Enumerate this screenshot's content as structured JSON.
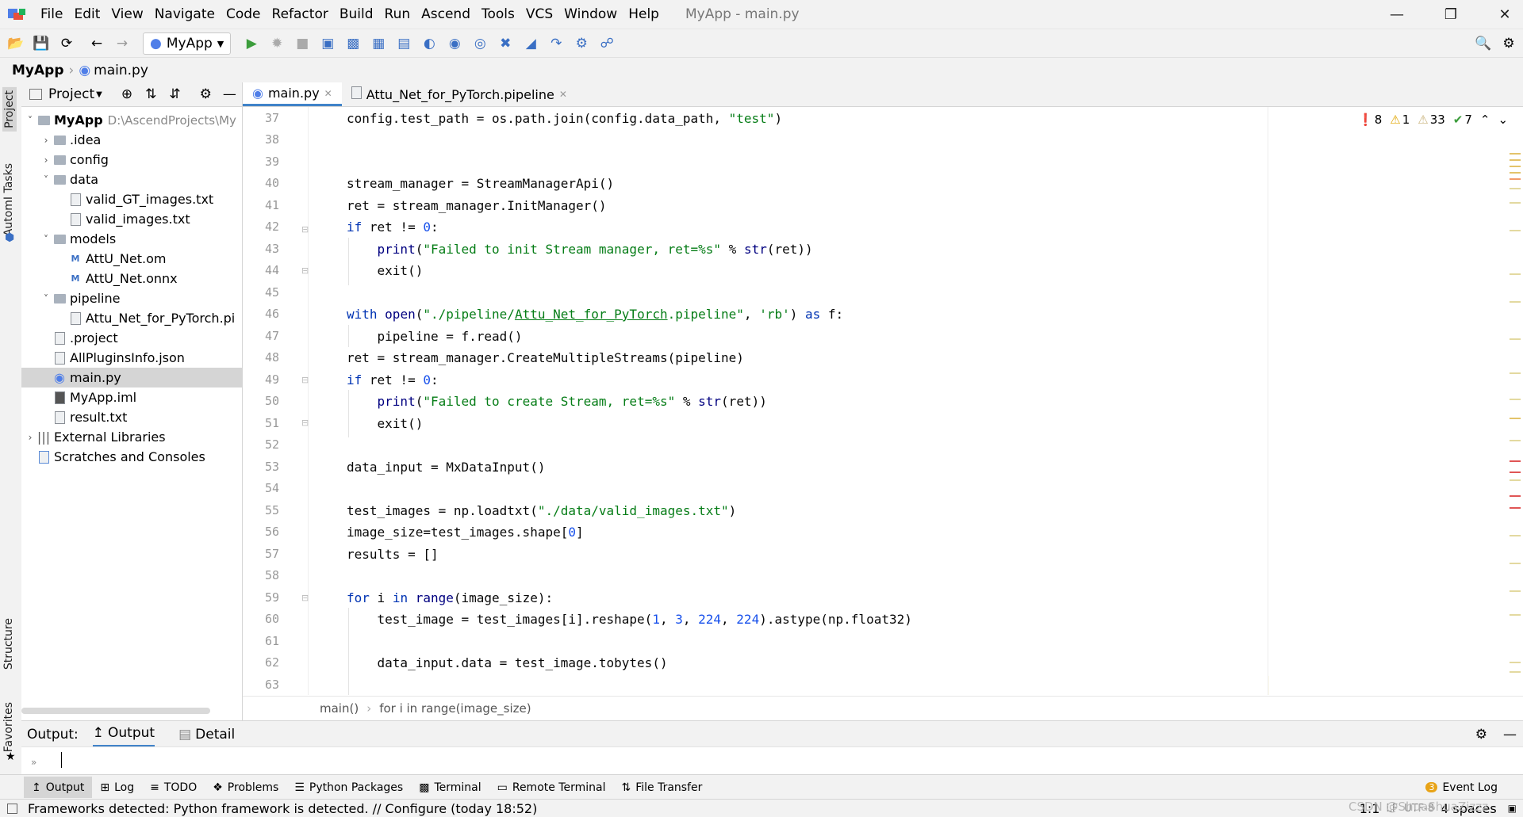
{
  "app": {
    "window_title": "MyApp - main.py",
    "menu": [
      "File",
      "Edit",
      "View",
      "Navigate",
      "Code",
      "Refactor",
      "Build",
      "Run",
      "Ascend",
      "Tools",
      "VCS",
      "Window",
      "Help"
    ],
    "run_config": "MyApp"
  },
  "breadcrumb": {
    "project": "MyApp",
    "file": "main.py"
  },
  "side_tabs": {
    "project": "Project",
    "automl": "AutomI Tasks",
    "structure": "Structure",
    "favorites": "Favorites"
  },
  "project_panel": {
    "title": "Project",
    "tree": [
      {
        "label": "MyApp",
        "path": "D:\\AscendProjects\\My",
        "type": "root"
      },
      {
        "label": ".idea",
        "type": "folder"
      },
      {
        "label": "config",
        "type": "folder"
      },
      {
        "label": "data",
        "type": "folder"
      },
      {
        "label": "valid_GT_images.txt",
        "type": "file"
      },
      {
        "label": "valid_images.txt",
        "type": "file"
      },
      {
        "label": "models",
        "type": "folder"
      },
      {
        "label": "AttU_Net.om",
        "type": "model"
      },
      {
        "label": "AttU_Net.onnx",
        "type": "model"
      },
      {
        "label": "pipeline",
        "type": "folder"
      },
      {
        "label": "Attu_Net_for_PyTorch.pi",
        "type": "file"
      },
      {
        "label": ".project",
        "type": "file"
      },
      {
        "label": "AllPluginsInfo.json",
        "type": "file"
      },
      {
        "label": "main.py",
        "type": "py"
      },
      {
        "label": "MyApp.iml",
        "type": "file"
      },
      {
        "label": "result.txt",
        "type": "file"
      },
      {
        "label": "External Libraries",
        "type": "lib"
      },
      {
        "label": "Scratches and Consoles",
        "type": "scratch"
      }
    ]
  },
  "editor": {
    "tabs": [
      "main.py",
      "Attu_Net_for_PyTorch.pipeline"
    ],
    "inspection": {
      "errors": "8",
      "warnings": "1",
      "weak_warnings": "33",
      "ok": "7"
    },
    "line_numbers": [
      "37",
      "38",
      "39",
      "40",
      "41",
      "42",
      "43",
      "44",
      "45",
      "46",
      "47",
      "48",
      "49",
      "50",
      "51",
      "52",
      "53",
      "54",
      "55",
      "56",
      "57",
      "58",
      "59",
      "60",
      "61",
      "62",
      "63"
    ],
    "crumbs": [
      "main()",
      "for i in range(image_size)"
    ]
  },
  "output": {
    "label": "Output:",
    "tab_output": "Output",
    "tab_detail": "Detail"
  },
  "bottom_tabs": [
    "Output",
    "Log",
    "TODO",
    "Problems",
    "Python Packages",
    "Terminal",
    "Remote Terminal",
    "File Transfer"
  ],
  "event_log": {
    "count": "3",
    "label": "Event Log"
  },
  "status": {
    "message": "Frameworks detected: Python framework is detected. // Configure (today 18:52)",
    "position": "1:1",
    "line_sep": "LF",
    "encoding": "UTF-8",
    "indent": "4 spaces",
    "watermark": "CSDN @ShuaShuaZizzz"
  }
}
